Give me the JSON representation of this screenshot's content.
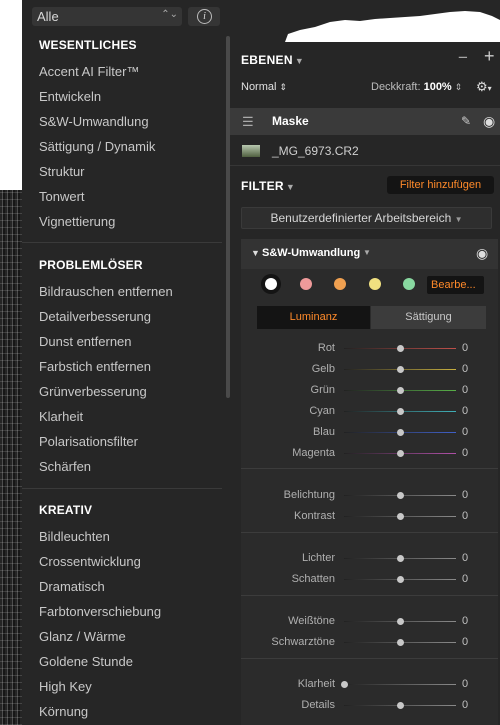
{
  "left_panel": {
    "filter_select_value": "Alle",
    "info_icon": "info-icon",
    "sections": [
      {
        "title": "WESENTLICHES",
        "items": [
          "Accent AI Filter™",
          "Entwickeln",
          "S&W-Umwandlung",
          "Sättigung / Dynamik",
          "Struktur",
          "Tonwert",
          "Vignettierung"
        ]
      },
      {
        "title": "PROBLEMLÖSER",
        "items": [
          "Bildrauschen entfernen",
          "Detailverbesserung",
          "Dunst entfernen",
          "Farbstich entfernen",
          "Grünverbesserung",
          "Klarheit",
          "Polarisationsfilter",
          "Schärfen"
        ]
      },
      {
        "title": "KREATIV",
        "items": [
          "Bildleuchten",
          "Crossentwicklung",
          "Dramatisch",
          "Farbtonverschiebung",
          "Glanz / Wärme",
          "Goldene Stunde",
          "High Key",
          "Körnung"
        ]
      }
    ]
  },
  "layers": {
    "title": "EBENEN",
    "blend_mode": "Normal",
    "opacity_label": "Deckkraft:",
    "opacity_value": "100%",
    "mask_label": "Maske",
    "layer_name": "_MG_6973.CR2"
  },
  "filters": {
    "title": "FILTER",
    "add_filter_label": "Filter hinzufügen",
    "workspace_label": "Benutzerdefinierter Arbeitsbereich",
    "active_filter": {
      "name": "S&W-Umwandlung",
      "edit_label": "Bearbe...",
      "color_presets": [
        "#ffffff",
        "#ef9a9a",
        "#f0a050",
        "#f0e080",
        "#88d8a0"
      ],
      "tabs": [
        "Luminanz",
        "Sättigung"
      ],
      "active_tab": "Luminanz",
      "accent_color": "#ff8a2a",
      "sliders": [
        {
          "label": "Rot",
          "value": "0",
          "color": "#c0504a",
          "level": 0.5
        },
        {
          "label": "Gelb",
          "value": "0",
          "color": "#c8b040",
          "level": 0.5
        },
        {
          "label": "Grün",
          "value": "0",
          "color": "#58b048",
          "level": 0.5
        },
        {
          "label": "Cyan",
          "value": "0",
          "color": "#40b0b8",
          "level": 0.5
        },
        {
          "label": "Blau",
          "value": "0",
          "color": "#4060c8",
          "level": 0.5
        },
        {
          "label": "Magenta",
          "value": "0",
          "color": "#b050a8",
          "level": 0.5
        },
        {
          "label": "Belichtung",
          "value": "0",
          "color": "#8a8a8a",
          "level": 0.5
        },
        {
          "label": "Kontrast",
          "value": "0",
          "color": "#8a8a8a",
          "level": 0.5
        },
        {
          "label": "Lichter",
          "value": "0",
          "color": "#8a8a8a",
          "level": 0.5
        },
        {
          "label": "Schatten",
          "value": "0",
          "color": "#8a8a8a",
          "level": 0.5
        },
        {
          "label": "Weißtöne",
          "value": "0",
          "color": "#8a8a8a",
          "level": 0.5
        },
        {
          "label": "Schwarztöne",
          "value": "0",
          "color": "#8a8a8a",
          "level": 0.5
        },
        {
          "label": "Klarheit",
          "value": "0",
          "color": "#8a8a8a",
          "level": 0.0
        },
        {
          "label": "Details",
          "value": "0",
          "color": "#8a8a8a",
          "level": 0.5
        }
      ]
    }
  }
}
